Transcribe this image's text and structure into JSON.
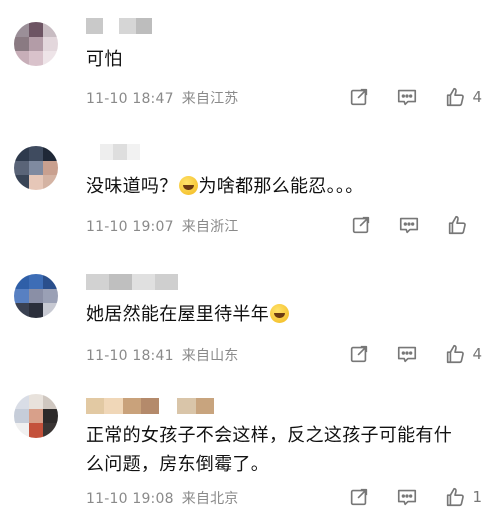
{
  "comments": [
    {
      "text": "可怕",
      "date": "11-10 18:47",
      "location": "来自江苏",
      "like_count": "4",
      "avatar_colors": [
        "#9b8f98",
        "#6d5463",
        "#c8bcc2",
        "#8a7a82",
        "#b39ca7",
        "#e3d7dc",
        "#c7aeb8",
        "#d9c2cb",
        "#eee4e8"
      ],
      "username_colors": [
        "#c9c9c9",
        "#ffffff",
        "#d6d6d6",
        "#bdbdbd"
      ]
    },
    {
      "text_before": "没味道吗？",
      "text_after": "为啥都那么能忍。。。",
      "emoji_name": "laughing-tears-emoji",
      "date": "11-10 19:07",
      "location": "来自浙江",
      "like_count": "",
      "avatar_colors": [
        "#2e3a4d",
        "#3f4b5f",
        "#1f2837",
        "#5a6478",
        "#7f8aa0",
        "#c9a08f",
        "#394456",
        "#e6c7b8",
        "#d4b3a3"
      ],
      "username_colors": [
        "#ffffff",
        "#eeeeee",
        "#dedede",
        "#f2f2f2"
      ]
    },
    {
      "text": "她居然能在屋里待半年",
      "emoji_name": "laughing-tears-emoji",
      "date": "11-10 18:41",
      "location": "来自山东",
      "like_count": "4",
      "avatar_colors": [
        "#2f5fa8",
        "#3d6db6",
        "#2a4f8c",
        "#5880c2",
        "#8a8fa6",
        "#9aa0b5",
        "#3a4152",
        "#2b2f3b",
        "#c7c9d2"
      ],
      "username_colors": [
        "#d2d2d2",
        "#bfbfbf",
        "#e0e0e0",
        "#cfcfcf"
      ]
    },
    {
      "text": "正常的女孩子不会这样，反之这孩子可能有什么问题，房东倒霉了。",
      "date": "11-10 19:08",
      "location": "来自北京",
      "like_count": "1",
      "avatar_colors": [
        "#d9dde6",
        "#e8e2dc",
        "#cfc7c0",
        "#c6cdd9",
        "#d8a08a",
        "#2d2a2a",
        "#f0f0f0",
        "#c4513b",
        "#3a3534"
      ],
      "username_colors": [
        "#e2c9a3",
        "#f0d7b8",
        "#c9a27b",
        "#b48a6b",
        "#ffffff",
        "#d9c5a9",
        "#c8a47e"
      ]
    }
  ],
  "icons": {
    "share": "share-icon",
    "comment": "comment-icon",
    "like": "thumbs-up-icon"
  }
}
